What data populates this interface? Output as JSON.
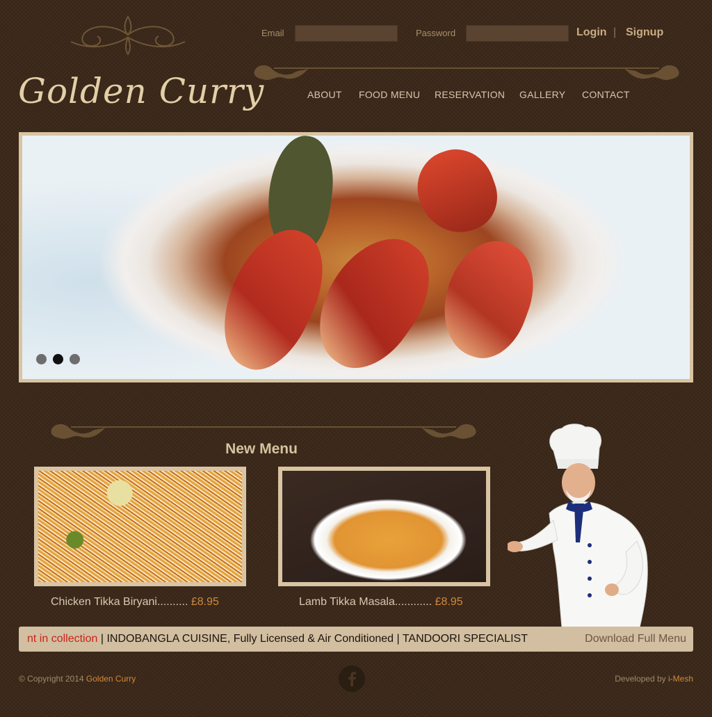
{
  "auth": {
    "email_label": "Email",
    "password_label": "Password",
    "login": "Login",
    "separator": "|",
    "signup": "Signup"
  },
  "brand": {
    "logo_text": "Golden Curry"
  },
  "nav": {
    "items": [
      "ABOUT",
      "FOOD MENU",
      "RESERVATION",
      "GALLERY",
      "CONTACT"
    ]
  },
  "hero": {
    "slide_count": 3,
    "active_slide": 2
  },
  "new_menu": {
    "title": "New Menu",
    "items": [
      {
        "name": "Chicken Tikka Biryani",
        "dots": "..........",
        "price": "£8.95"
      },
      {
        "name": "Lamb Tikka Masala",
        "dots": "............",
        "price": "£8.95"
      }
    ]
  },
  "ticker": {
    "red_text": "nt in collection",
    "text": " | INDOBANGLA CUISINE, Fully Licensed & Air Conditioned | TANDOORI SPECIALIST",
    "download": "Download Full Menu"
  },
  "footer": {
    "copyright": "© Copyright 2014 ",
    "copyright_brand": "Golden Curry",
    "developed": "Developed by ",
    "developer": "i-Mesh"
  },
  "colors": {
    "background": "#3a2718",
    "accent": "#d3893c",
    "frame": "#d9c4a3",
    "ticker": "#d2bea0"
  }
}
